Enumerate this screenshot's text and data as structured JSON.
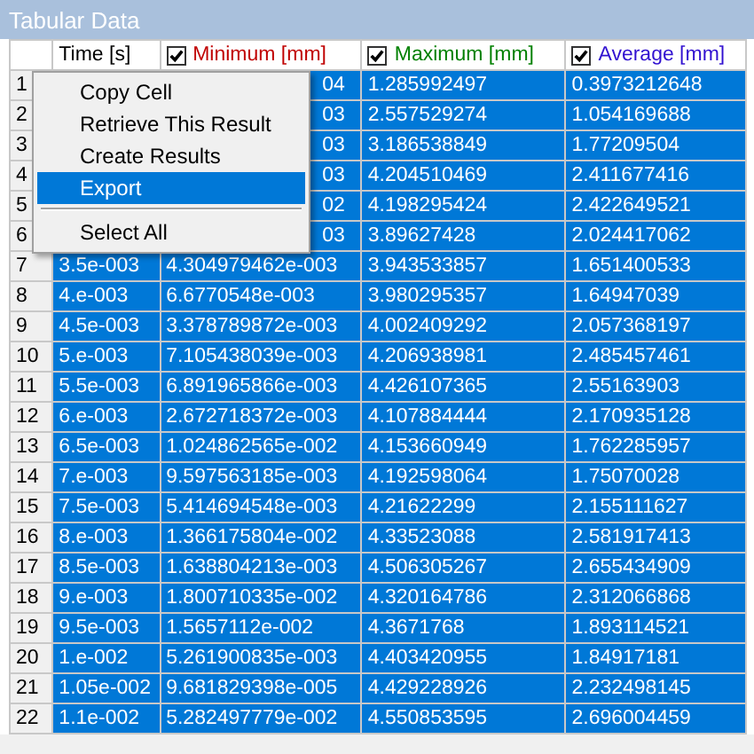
{
  "window": {
    "title": "Tabular Data"
  },
  "table": {
    "columns": [
      {
        "label": "Time [s]",
        "kind": "plain"
      },
      {
        "label": "Minimum [mm]",
        "kind": "check",
        "checked": true,
        "color": "#c00000"
      },
      {
        "label": "Maximum [mm]",
        "kind": "check",
        "checked": true,
        "color": "#008000"
      },
      {
        "label": "Average [mm]",
        "kind": "check",
        "checked": true,
        "color": "#3010d0"
      }
    ],
    "rows": [
      {
        "number": "1",
        "selected": true,
        "cells": [
          null,
          {
            "text": "04",
            "cut": true
          },
          {
            "text": "1.285992497"
          },
          {
            "text": "0.3973212648"
          }
        ]
      },
      {
        "number": "2",
        "selected": true,
        "cells": [
          null,
          {
            "text": "03",
            "cut": true
          },
          {
            "text": "2.557529274"
          },
          {
            "text": "1.054169688"
          }
        ]
      },
      {
        "number": "3",
        "selected": true,
        "cells": [
          null,
          {
            "text": "03",
            "cut": true
          },
          {
            "text": "3.186538849"
          },
          {
            "text": "1.77209504"
          }
        ]
      },
      {
        "number": "4",
        "selected": true,
        "cells": [
          null,
          {
            "text": "03",
            "cut": true
          },
          {
            "text": "4.204510469"
          },
          {
            "text": "2.411677416"
          }
        ]
      },
      {
        "number": "5",
        "selected": true,
        "cells": [
          null,
          {
            "text": "02",
            "cut": true
          },
          {
            "text": "4.198295424"
          },
          {
            "text": "2.422649521"
          }
        ]
      },
      {
        "number": "6",
        "selected": true,
        "cells": [
          null,
          {
            "text": "03",
            "cut": true
          },
          {
            "text": "3.89627428"
          },
          {
            "text": "2.024417062"
          }
        ]
      },
      {
        "number": "7",
        "selected": true,
        "cells": [
          {
            "text": "3.5e-003"
          },
          {
            "text": "4.304979462e-003"
          },
          {
            "text": "3.943533857"
          },
          {
            "text": "1.651400533"
          }
        ]
      },
      {
        "number": "8",
        "selected": true,
        "cells": [
          {
            "text": "4.e-003"
          },
          {
            "text": "6.6770548e-003"
          },
          {
            "text": "3.980295357"
          },
          {
            "text": "1.64947039"
          }
        ]
      },
      {
        "number": "9",
        "selected": true,
        "cells": [
          {
            "text": "4.5e-003"
          },
          {
            "text": "3.378789872e-003"
          },
          {
            "text": "4.002409292"
          },
          {
            "text": "2.057368197"
          }
        ]
      },
      {
        "number": "10",
        "selected": true,
        "cells": [
          {
            "text": "5.e-003"
          },
          {
            "text": "7.105438039e-003"
          },
          {
            "text": "4.206938981"
          },
          {
            "text": "2.485457461"
          }
        ]
      },
      {
        "number": "11",
        "selected": true,
        "cells": [
          {
            "text": "5.5e-003"
          },
          {
            "text": "6.891965866e-003"
          },
          {
            "text": "4.426107365"
          },
          {
            "text": "2.55163903"
          }
        ]
      },
      {
        "number": "12",
        "selected": true,
        "cells": [
          {
            "text": "6.e-003"
          },
          {
            "text": "2.672718372e-003"
          },
          {
            "text": "4.107884444"
          },
          {
            "text": "2.170935128"
          }
        ]
      },
      {
        "number": "13",
        "selected": true,
        "cells": [
          {
            "text": "6.5e-003"
          },
          {
            "text": "1.024862565e-002"
          },
          {
            "text": "4.153660949"
          },
          {
            "text": "1.762285957"
          }
        ]
      },
      {
        "number": "14",
        "selected": true,
        "cells": [
          {
            "text": "7.e-003"
          },
          {
            "text": "9.597563185e-003"
          },
          {
            "text": "4.192598064"
          },
          {
            "text": "1.75070028"
          }
        ]
      },
      {
        "number": "15",
        "selected": true,
        "cells": [
          {
            "text": "7.5e-003"
          },
          {
            "text": "5.414694548e-003"
          },
          {
            "text": "4.21622299"
          },
          {
            "text": "2.155111627"
          }
        ]
      },
      {
        "number": "16",
        "selected": true,
        "cells": [
          {
            "text": "8.e-003"
          },
          {
            "text": "1.366175804e-002"
          },
          {
            "text": "4.33523088"
          },
          {
            "text": "2.581917413"
          }
        ]
      },
      {
        "number": "17",
        "selected": true,
        "cells": [
          {
            "text": "8.5e-003"
          },
          {
            "text": "1.638804213e-003"
          },
          {
            "text": "4.506305267"
          },
          {
            "text": "2.655434909"
          }
        ]
      },
      {
        "number": "18",
        "selected": true,
        "cells": [
          {
            "text": "9.e-003"
          },
          {
            "text": "1.800710335e-002"
          },
          {
            "text": "4.320164786"
          },
          {
            "text": "2.312066868"
          }
        ]
      },
      {
        "number": "19",
        "selected": true,
        "cells": [
          {
            "text": "9.5e-003"
          },
          {
            "text": "1.5657112e-002"
          },
          {
            "text": "4.3671768"
          },
          {
            "text": "1.893114521"
          }
        ]
      },
      {
        "number": "20",
        "selected": true,
        "cells": [
          {
            "text": "1.e-002"
          },
          {
            "text": "5.261900835e-003"
          },
          {
            "text": "4.403420955"
          },
          {
            "text": "1.84917181"
          }
        ]
      },
      {
        "number": "21",
        "selected": true,
        "cells": [
          {
            "text": "1.05e-002"
          },
          {
            "text": "9.681829398e-005"
          },
          {
            "text": "4.429228926"
          },
          {
            "text": "2.232498145"
          }
        ]
      },
      {
        "number": "22",
        "selected": true,
        "cells": [
          {
            "text": "1.1e-002"
          },
          {
            "text": "5.282497779e-002"
          },
          {
            "text": "4.550853595"
          },
          {
            "text": "2.696004459"
          }
        ]
      }
    ]
  },
  "context_menu": {
    "items": [
      {
        "kind": "item",
        "label": "Copy Cell",
        "selected": false
      },
      {
        "kind": "item",
        "label": "Retrieve This Result",
        "selected": false
      },
      {
        "kind": "item",
        "label": "Create Results",
        "selected": false
      },
      {
        "kind": "item",
        "label": "Export",
        "selected": true
      },
      {
        "kind": "separator"
      },
      {
        "kind": "item",
        "label": "Select All",
        "selected": false
      }
    ]
  }
}
